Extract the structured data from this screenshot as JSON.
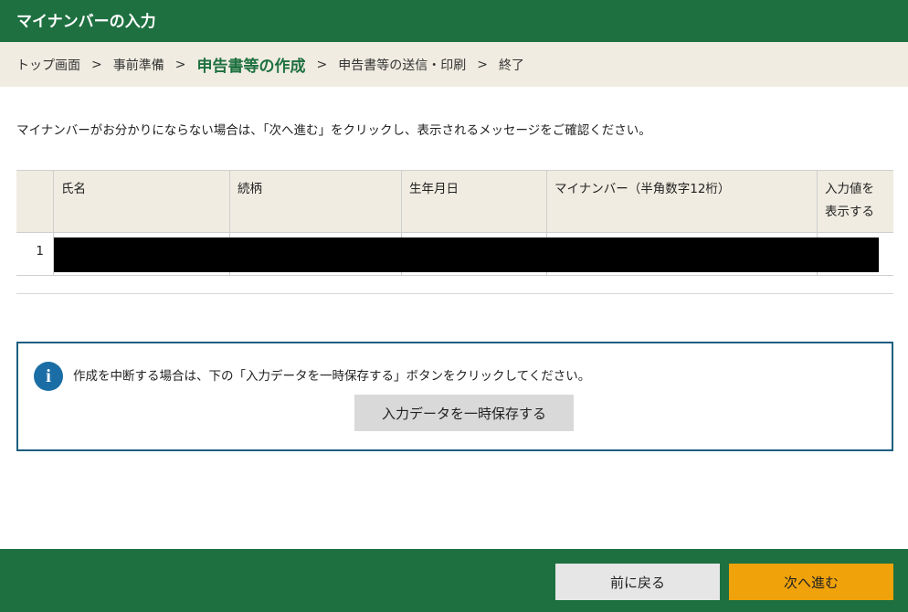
{
  "header": {
    "title": "マイナンバーの入力"
  },
  "breadcrumb": {
    "items": [
      "トップ画面",
      "事前準備",
      "申告書等の作成",
      "申告書等の送信・印刷",
      "終了"
    ],
    "separator": ">"
  },
  "intro": "マイナンバーがお分かりにならない場合は、「次へ進む」をクリックし、表示されるメッセージをご確認ください。",
  "table": {
    "headers": [
      "",
      "氏名",
      "続柄",
      "生年月日",
      "マイナンバー（半角数字12桁）",
      "入力値を表示する"
    ],
    "rows": [
      {
        "num": "1"
      }
    ]
  },
  "notice": {
    "icon": "info-icon",
    "text": "作成を中断する場合は、下の「入力データを一時保存する」ボタンをクリックしてください。",
    "save_label": "入力データを一時保存する"
  },
  "footer": {
    "back_label": "前に戻る",
    "next_label": "次へ進む"
  },
  "colors": {
    "brand_green": "#1e7040",
    "next_orange": "#f0a20a",
    "info_blue": "#1b6ea5"
  }
}
